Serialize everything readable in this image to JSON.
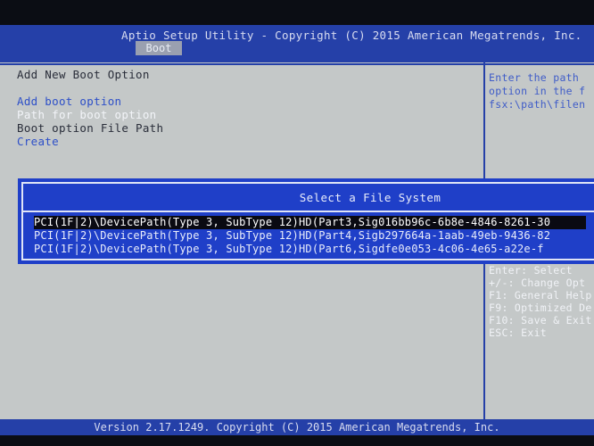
{
  "header": {
    "title": "Aptio Setup Utility - Copyright (C) 2015 American Megatrends, Inc.",
    "active_tab": "Boot"
  },
  "main": {
    "heading": "Add New Boot Option",
    "items": [
      {
        "label": "Add boot option",
        "style": "blue"
      },
      {
        "label": "Path for boot option",
        "style": "white"
      },
      {
        "label": "Boot option File Path",
        "style": "dark"
      },
      {
        "label": "Create",
        "style": "blue"
      }
    ]
  },
  "help": {
    "lines": [
      "Enter the path",
      "option in the f",
      "fsx:\\path\\filen"
    ]
  },
  "keys": {
    "lines": [
      "Enter: Select",
      "+/-: Change Opt",
      "F1: General Help",
      "F9: Optimized De",
      "F10: Save & Exit",
      "ESC: Exit"
    ]
  },
  "popup": {
    "title": "Select a File System",
    "items": [
      {
        "label": "PCI(1F|2)\\DevicePath(Type 3, SubType 12)HD(Part3,Sig016bb96c-6b8e-4846-8261-30",
        "selected": true
      },
      {
        "label": "PCI(1F|2)\\DevicePath(Type 3, SubType 12)HD(Part4,Sigb297664a-1aab-49eb-9436-82",
        "selected": false
      },
      {
        "label": "PCI(1F|2)\\DevicePath(Type 3, SubType 12)HD(Part6,Sigdfe0e053-4c06-4e65-a22e-f",
        "selected": false
      }
    ]
  },
  "footer": {
    "text": "Version 2.17.1249. Copyright (C) 2015 American Megatrends, Inc."
  },
  "colors": {
    "header_blue": "#2540a8",
    "popup_blue": "#1f3fc8",
    "screen_gray": "#c4c8c8",
    "link_blue": "#2d4fc8"
  }
}
